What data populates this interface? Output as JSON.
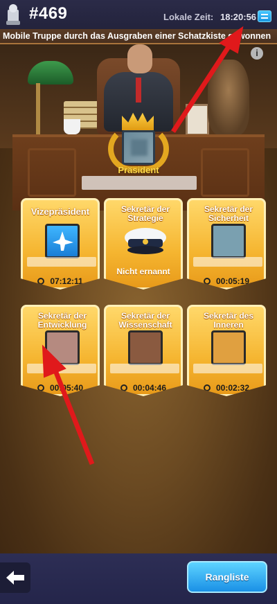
{
  "header": {
    "server_number": "#469",
    "time_label": "Lokale Zeit:",
    "time_value": "18:20:56"
  },
  "ticker": {
    "text": "Mobile Truppe durch das Ausgraben einer Schatzkiste gewonnen"
  },
  "president": {
    "label": "Präsident"
  },
  "positions": [
    {
      "title": "Vizepräsident",
      "timer": "07:12:11",
      "icon": "plane-icon"
    },
    {
      "title": "Sekretär der Strategie",
      "status": "Nicht ernannt",
      "icon": "officer-hat-icon"
    },
    {
      "title": "Sekretär der Sicherheit",
      "timer": "00:05:19",
      "icon": "portrait"
    },
    {
      "title": "Sekretär der Entwicklung",
      "timer": "00:05:40",
      "icon": "portrait"
    },
    {
      "title": "Sekretär der Wissenschaft",
      "timer": "00:04:46",
      "icon": "portrait"
    },
    {
      "title": "Sekretär des Inneren",
      "timer": "00:02:32",
      "icon": "portrait"
    }
  ],
  "footer": {
    "rank_button": "Rangliste"
  },
  "colors": {
    "accent_gold": "#f5b530",
    "button_blue": "#1a90e6",
    "annotation_red": "#e0191b"
  }
}
